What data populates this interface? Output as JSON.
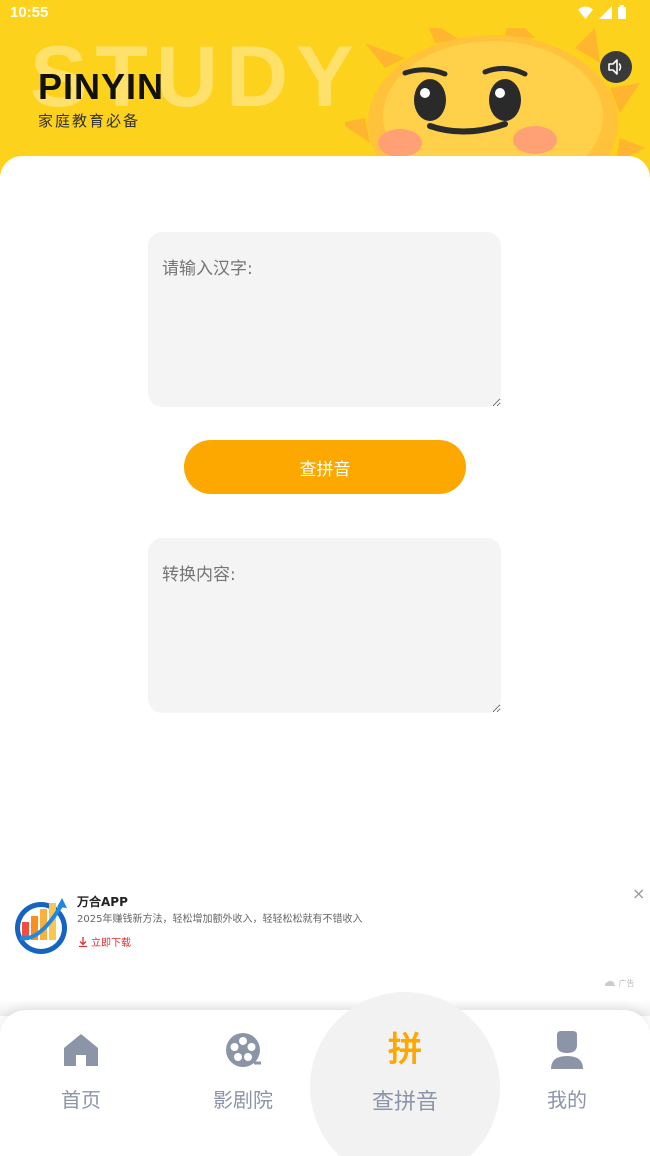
{
  "status": {
    "time": "10:55"
  },
  "header": {
    "bg_word": "STUDY",
    "title": "PINYIN",
    "subtitle": "家庭教育必备",
    "accent": "#fdd21c"
  },
  "main": {
    "input_placeholder": "请输入汉字:",
    "button_label": "查拼音",
    "output_placeholder": "转换内容:",
    "button_color": "#fca800"
  },
  "ad": {
    "title": "万合APP",
    "description": "2025年赚钱新方法，轻松增加额外收入，轻轻松松就有不错收入",
    "cta": "立即下载",
    "close": "×",
    "mark": "广告"
  },
  "nav": {
    "items": [
      {
        "label": "首页",
        "icon": "home-icon"
      },
      {
        "label": "影剧院",
        "icon": "film-reel-icon"
      },
      {
        "label": "查拼音",
        "icon": "pin-char-icon",
        "glyph": "拼"
      },
      {
        "label": "我的",
        "icon": "user-icon"
      }
    ]
  }
}
